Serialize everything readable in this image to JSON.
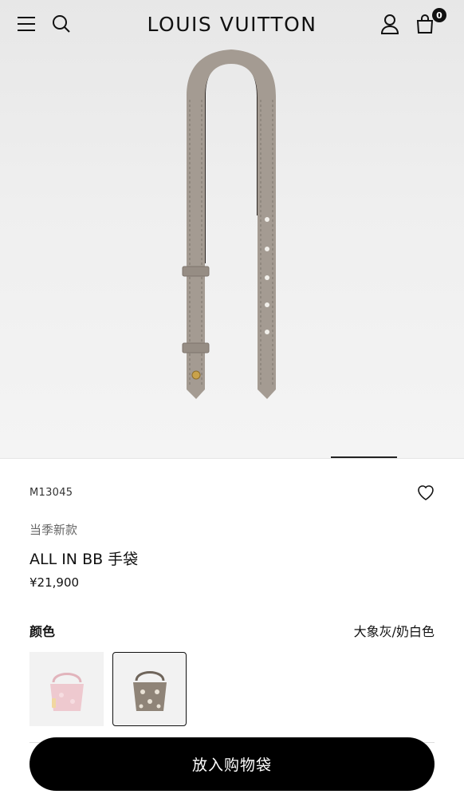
{
  "header": {
    "brand": "LOUIS VUITTON",
    "cart_count": "0",
    "icons": [
      "menu-icon",
      "search-icon",
      "account-icon",
      "shopping-bag-icon"
    ]
  },
  "product": {
    "sku": "M13045",
    "tag": "当季新款",
    "title": "ALL IN BB 手袋",
    "price": "¥21,900",
    "image_colors": {
      "strap": "#a39a91",
      "background": "#ededed"
    }
  },
  "color_section": {
    "label": "颜色",
    "selected": "大象灰/奶白色",
    "swatches": [
      {
        "name": "pink-variant",
        "color": "#eec9cf"
      },
      {
        "name": "taupe-variant",
        "color": "#8f8478"
      }
    ]
  },
  "cta": {
    "label": "放入购物袋"
  },
  "colors": {
    "accent": "#000000",
    "text": "#111111",
    "muted": "#666666"
  }
}
